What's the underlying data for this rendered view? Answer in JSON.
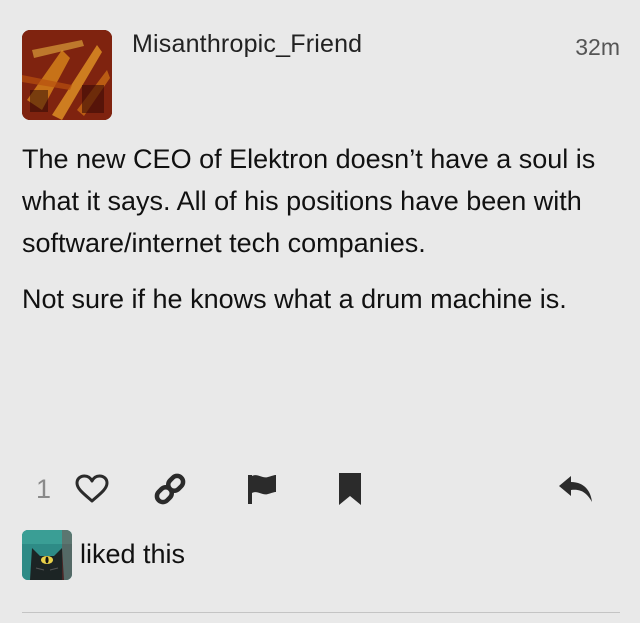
{
  "post": {
    "username": "Misanthropic_Friend",
    "timestamp": "32m",
    "paragraphs": [
      "The new CEO of Elektron doesn’t have a soul is what it says. All of his positions have been with software/internet tech companies.",
      "Not sure if he knows what a drum machine is."
    ]
  },
  "actions": {
    "like_count": "1",
    "icons": [
      "heart-icon",
      "link-icon",
      "flag-icon",
      "bookmark-icon",
      "reply-icon"
    ]
  },
  "liked_by": {
    "text": "liked this"
  },
  "colors": {
    "background": "#e9e9e9",
    "text": "#111111",
    "muted": "#8a8a8a",
    "icon": "#2b2b2b"
  }
}
